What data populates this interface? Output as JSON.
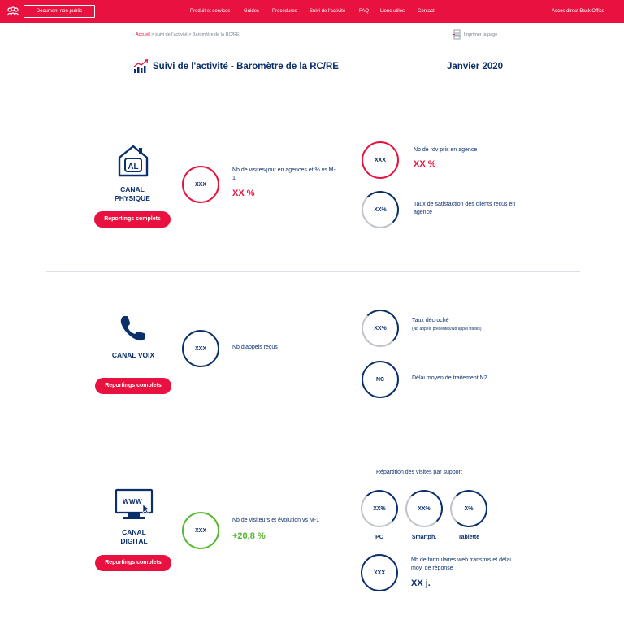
{
  "header": {
    "doc_badge": "Document non public",
    "nav": [
      "Produit et services",
      "Guides",
      "Procédures",
      "Suivi de l'activité",
      "FAQ",
      "Liens utiles",
      "Contact"
    ],
    "back_office": "Accès direct Back Office"
  },
  "breadcrumb": {
    "home": "Accueil",
    "rest": " > suivi de l'activité > Baromètre de la RC/RE"
  },
  "print_label": "Imprimer la page",
  "page": {
    "title": "Suivi de l'activité - Baromètre de la RC/RE",
    "period": "Janvier 2020"
  },
  "report_button": "Reportings complets",
  "physique": {
    "label_line1": "CANAL",
    "label_line2": "PHYSIQUE",
    "visits": {
      "ring": "XXX",
      "label": "Nb de visites/jour en agences et % vs M-1",
      "value": "XX %"
    },
    "rdv": {
      "ring": "XXX",
      "label": "Nb de rdv pris en agence",
      "value": "XX %"
    },
    "satisfaction": {
      "ring": "XX%",
      "label": "Taux de satisfaction des clients reçus en agence"
    }
  },
  "voix": {
    "label": "CANAL VOIX",
    "calls": {
      "ring": "XXX",
      "label": "Nb d'appels reçus"
    },
    "decroche": {
      "ring": "XX%",
      "label": "Taux décroché",
      "sub": "(Nb appels présentés/Nb appel traités)"
    },
    "delai": {
      "ring": "NC",
      "label": "Délai moyen de traitement N2"
    }
  },
  "digital": {
    "label_line1": "CANAL",
    "label_line2": "DIGITAL",
    "www": "WWW",
    "visitors": {
      "ring": "XXX",
      "label": "Nb de visiteurs et évolution vs M-1",
      "value": "+20,8 %"
    },
    "support_title": "Répartition des visites par support",
    "supports": [
      {
        "ring": "XX%",
        "label": "PC"
      },
      {
        "ring": "XX%",
        "label": "Smartph."
      },
      {
        "ring": "X%",
        "label": "Tablette"
      }
    ],
    "forms": {
      "ring": "XXX",
      "label": "Nb de formulaires web transmis et délai moy. de réponse",
      "value": "XX j."
    }
  },
  "colors": {
    "brand_red": "#e8113f",
    "navy": "#0b2f6b",
    "green": "#55b82e",
    "grey_ring": "#bfc4cc"
  }
}
